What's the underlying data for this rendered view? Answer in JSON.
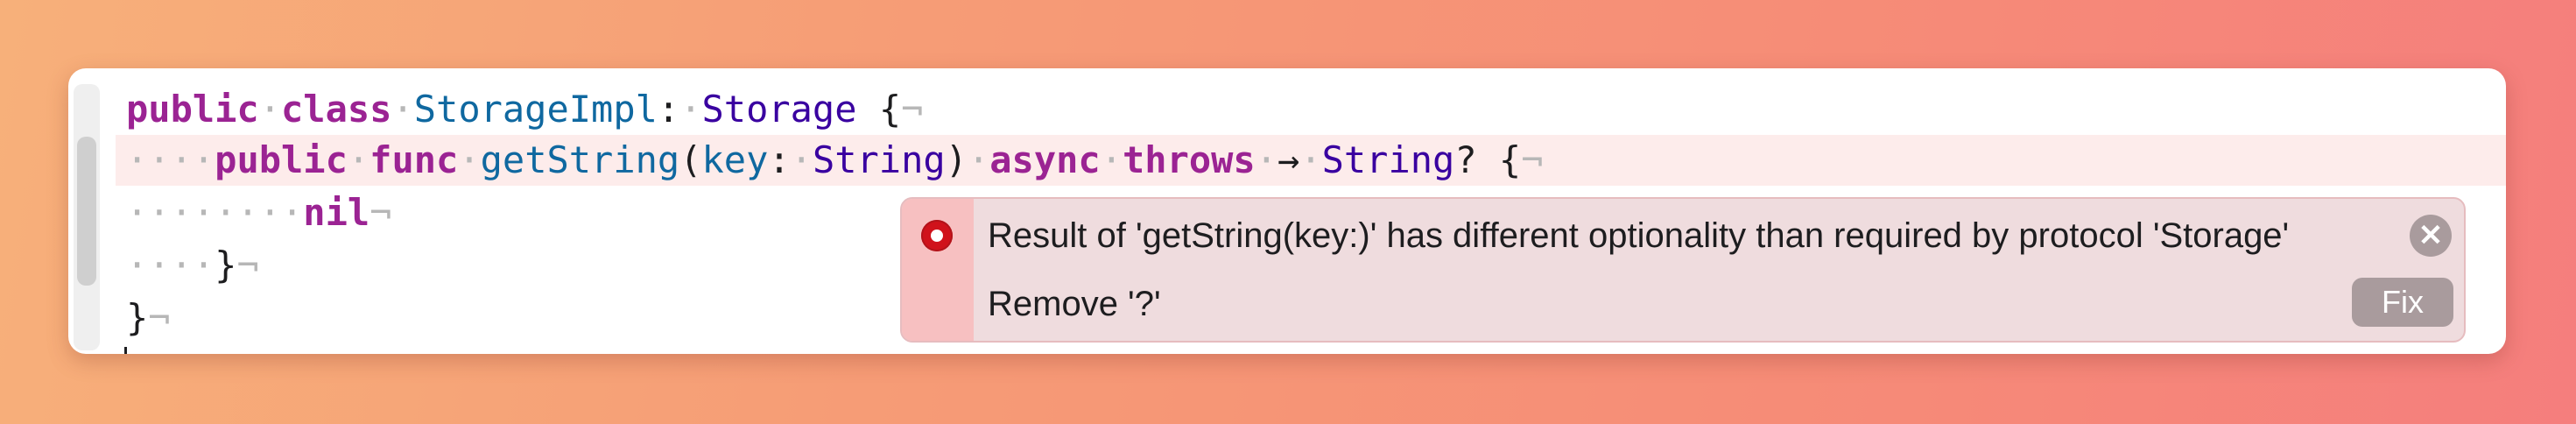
{
  "editor": {
    "lines": [
      {
        "tokens": {
          "kw1": "public",
          "s1": "·",
          "kw2": "class",
          "s2": "·",
          "type1": "StorageImpl",
          "colon": ":",
          "s3": "·",
          "type2": "Storage",
          "s4": " ",
          "brace": "{",
          "eol": "¬"
        }
      },
      {
        "tokens": {
          "indent": "····",
          "kw1": "public",
          "s1": "·",
          "kw2": "func",
          "s2": "·",
          "name": "getString",
          "paren_open": "(",
          "param": "key",
          "colon": ":",
          "s3": "·",
          "ptype": "String",
          "paren_close": ")",
          "s4": "·",
          "kw3": "async",
          "s5": "·",
          "kw4": "throws",
          "s6": "·",
          "arrow": "→",
          "s7": "·",
          "rtype": "String",
          "optional": "?",
          "s8": " ",
          "brace": "{",
          "eol": "¬"
        }
      },
      {
        "tokens": {
          "indent": "········",
          "kw": "nil",
          "eol": "¬"
        }
      },
      {
        "tokens": {
          "indent": "····",
          "brace": "}",
          "eol": "¬"
        }
      },
      {
        "tokens": {
          "brace": "}",
          "eol": "¬"
        }
      }
    ]
  },
  "diagnostic": {
    "icon": "error-icon",
    "message": "Result of 'getString(key:)' has different optionality than required by protocol 'Storage'",
    "fix_description": "Remove '?'",
    "close_symbol": "✕",
    "fix_button_label": "Fix"
  },
  "colors": {
    "keyword": "#9b2393",
    "type": "#3900a0",
    "declaration": "#0f68a0",
    "highlight_line": "#fdeceb",
    "error_strip": "#f7c0c1",
    "error_icon": "#d0121b"
  }
}
